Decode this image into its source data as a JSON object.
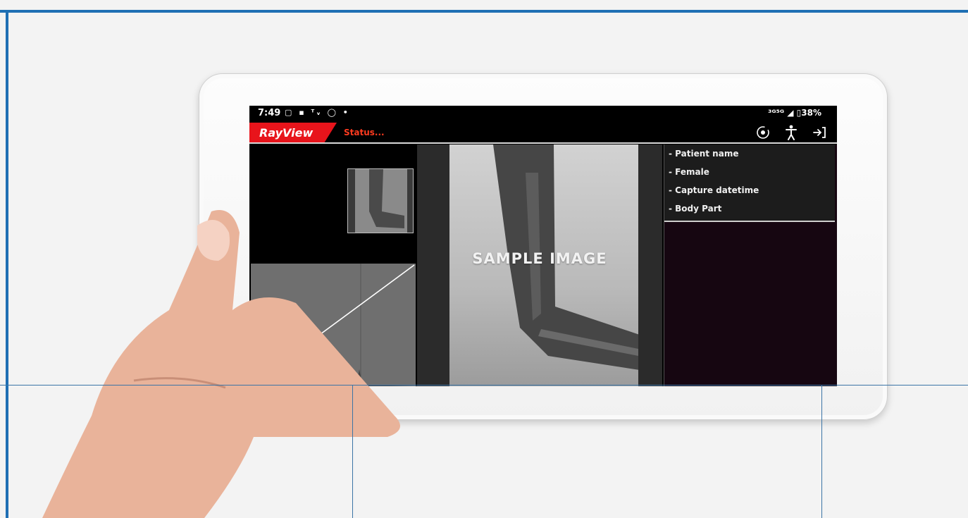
{
  "status_bar": {
    "time": "7:49",
    "left_icons": "▢ ▪ ᵀᵥ ◯ •",
    "right_text": "³ᴳ⁵ᴳ ◢ ▯38%"
  },
  "app_bar": {
    "logo": "RayView",
    "status": "Status...",
    "actions": [
      {
        "icon": "rotate-icon"
      },
      {
        "icon": "body-figure-icon"
      },
      {
        "icon": "logout-icon"
      }
    ]
  },
  "image_view": {
    "watermark": "SAMPLE IMAGE"
  },
  "patient_info": {
    "items": [
      "- Patient name",
      "- Female",
      "- Capture datetime",
      "- Body Part"
    ]
  },
  "colors": {
    "brand_red": "#e8141b",
    "status_orange": "#ff3b1f",
    "frame_blue": "#1f6fb4"
  }
}
